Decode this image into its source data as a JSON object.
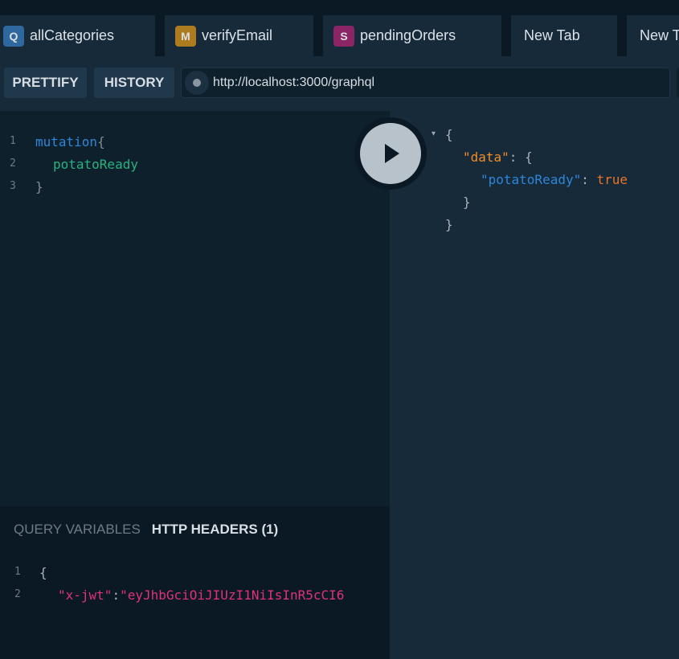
{
  "tabs": [
    {
      "badge": "Q",
      "badge_color": "#3373b0",
      "label": "allCategories"
    },
    {
      "badge": "M",
      "badge_color": "#c98b1c",
      "label": "verifyEmail"
    },
    {
      "badge": "S",
      "badge_color": "#a0256e",
      "label": "pendingOrders"
    },
    {
      "label": "New Tab"
    },
    {
      "label": "New T"
    }
  ],
  "toolbar": {
    "prettify_label": "PRETTIFY",
    "history_label": "HISTORY",
    "endpoint_url": "http://localhost:3000/graphql"
  },
  "query_editor": {
    "line_numbers": [
      "1",
      "2",
      "3"
    ],
    "keyword": "mutation",
    "open_brace": "{",
    "field": "potatoReady",
    "close_brace": "}"
  },
  "result": {
    "arrow": "▾",
    "open_brace": "{",
    "data_key": "\"data\"",
    "colon": ": ",
    "data_open": "{",
    "field_key": "\"potatoReady\"",
    "field_value": "true",
    "data_close": "}",
    "close_brace": "}"
  },
  "variables_panel": {
    "query_variables_label": "QUERY VARIABLES",
    "http_headers_label": "HTTP HEADERS (1)",
    "line_numbers": [
      "1",
      "2"
    ],
    "open_brace": "{",
    "header_key": "\"x-jwt\"",
    "colon": ":",
    "header_value": "\"eyJhbGciOiJIUzI1NiIsInR5cCI6"
  },
  "colors": {
    "background": "#0f202d",
    "result_background": "#172a3a",
    "run_button": "#b8c2cb"
  }
}
